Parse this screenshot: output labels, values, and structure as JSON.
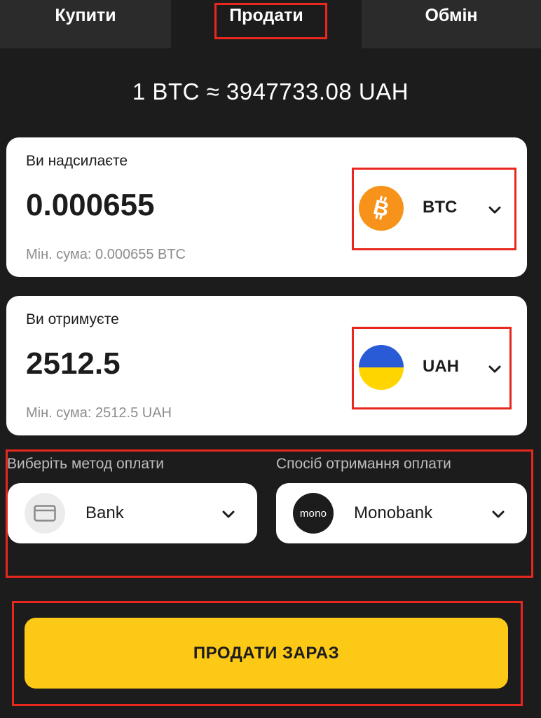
{
  "tabs": [
    {
      "label": "Купити",
      "active": false
    },
    {
      "label": "Продати",
      "active": true
    },
    {
      "label": "Обмін",
      "active": false
    }
  ],
  "rate": "1 BTC ≈ 3947733.08 UAH",
  "send": {
    "label": "Ви надсилаєте",
    "amount": "0.000655",
    "min": "Мін. сума: 0.000655 BTC",
    "currency": "BTC",
    "currency_icon": "bitcoin-icon"
  },
  "receive": {
    "label": "Ви отримуєте",
    "amount": "2512.5",
    "min": "Мін. сума: 2512.5 UAH",
    "currency": "UAH",
    "currency_icon": "ukraine-flag-icon"
  },
  "payment": {
    "method_label": "Виберіть метод оплати",
    "method_value": "Bank",
    "method_icon": "bank-card-icon",
    "receive_label": "Спосіб отримання оплати",
    "receive_value": "Monobank",
    "receive_icon_text": "mono"
  },
  "cta": {
    "label": "ПРОДАТИ ЗАРАЗ"
  },
  "colors": {
    "background": "#1c1c1c",
    "tab_inactive": "#2b2b2b",
    "card": "#ffffff",
    "accent_yellow": "#fcc917",
    "highlight_red": "#e8281e",
    "bitcoin_orange": "#f7931a",
    "flag_blue": "#2a5bd7",
    "flag_yellow": "#ffd500"
  }
}
